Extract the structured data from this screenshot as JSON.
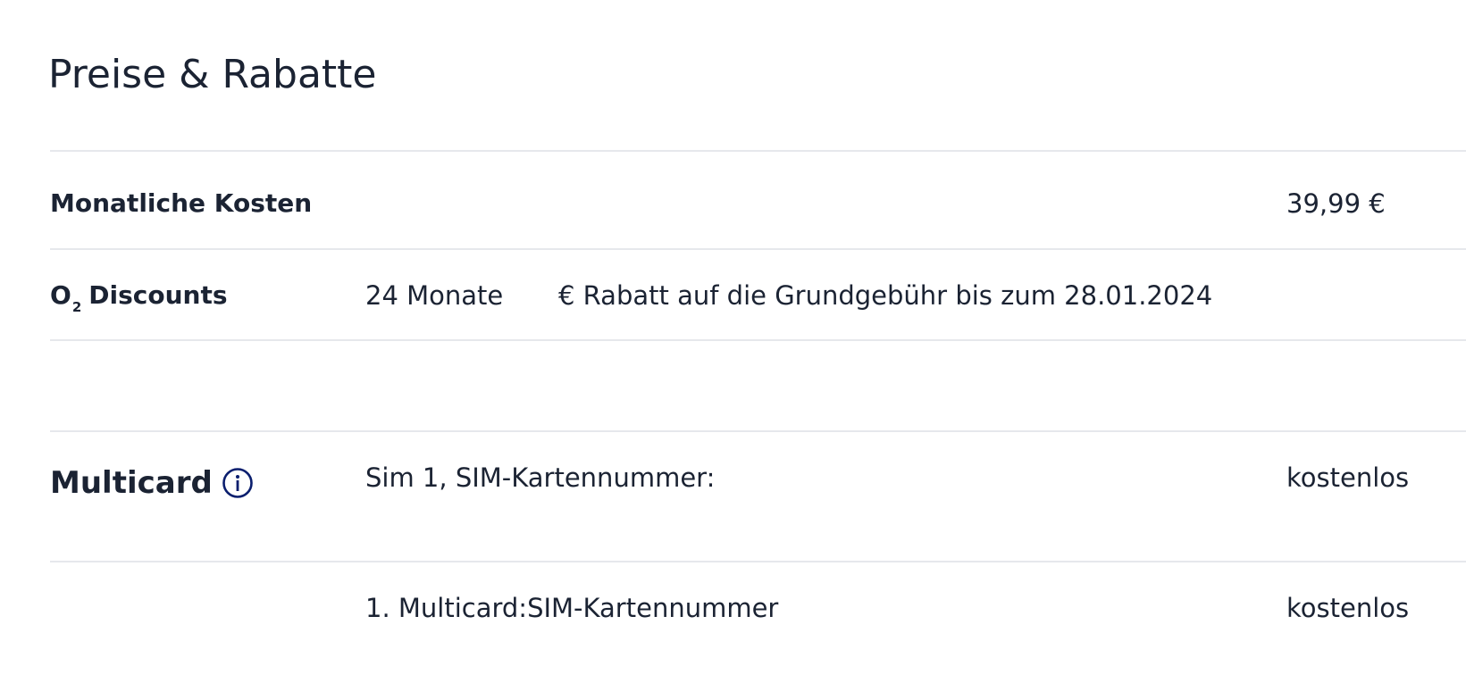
{
  "page": {
    "title": "Preise & Rabatte"
  },
  "monthly_costs": {
    "label": "Monatliche Kosten",
    "value": "39,99 €"
  },
  "discounts": {
    "label_prefix": "O",
    "label_subscript": "2",
    "label_suffix": "Discounts",
    "duration": "24 Monate",
    "description": "€ Rabatt auf die Grundgebühr bis zum 28.01.2024"
  },
  "multicard": {
    "label": "Multicard",
    "info_icon": "info-circle-icon",
    "rows": [
      {
        "description": "Sim 1, SIM-Kartennummer:",
        "price": "kostenlos"
      },
      {
        "description": "1. Multicard:SIM-Kartennummer",
        "price": "kostenlos"
      }
    ]
  },
  "colors": {
    "text": "#1b2333",
    "divider": "#e6e8ec",
    "icon": "#0a1e6e"
  }
}
